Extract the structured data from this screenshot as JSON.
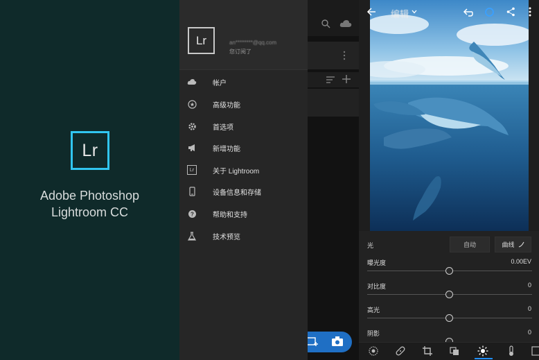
{
  "splash": {
    "logo_text": "Lr",
    "title_line1": "Adobe Photoshop",
    "title_line2": "Lightroom CC",
    "bg_color": "#0f2a2a",
    "accent": "#31c5f0"
  },
  "drawer": {
    "logo_text": "Lr",
    "user_email": "an********@qq.com",
    "user_status": "您订阅了",
    "menu": [
      {
        "icon": "cloud-icon",
        "label": "帐户"
      },
      {
        "icon": "star-circle-icon",
        "label": "高级功能"
      },
      {
        "icon": "gear-icon",
        "label": "首选项"
      },
      {
        "icon": "megaphone-icon",
        "label": "新增功能"
      },
      {
        "icon": "lr-icon",
        "icon_text": "Lr",
        "label": "关于 Lightroom"
      },
      {
        "icon": "phone-icon",
        "label": "设备信息和存储"
      },
      {
        "icon": "help-icon",
        "label": "帮助和支持"
      },
      {
        "icon": "flask-icon",
        "label": "技术预览"
      }
    ]
  },
  "editor": {
    "title": "编辑",
    "section": "光",
    "auto_label": "自动",
    "curve_label": "曲线",
    "sliders": [
      {
        "label": "曝光度",
        "value": "0.00EV",
        "level": 0.5
      },
      {
        "label": "对比度",
        "value": "0",
        "level": 0.5
      },
      {
        "label": "高光",
        "value": "0",
        "level": 0.5
      },
      {
        "label": "阴影",
        "value": "0",
        "level": 0.5
      }
    ],
    "tools": [
      "presets-icon",
      "healing-icon",
      "crop-icon",
      "selective-icon",
      "light-icon",
      "color-temp-icon",
      "effects-icon"
    ],
    "active_tool": "light-icon",
    "accent": "#1f8fff"
  },
  "icons": {
    "back": "back-arrow-icon",
    "undo": "undo-icon",
    "sync": "sync-icon",
    "share": "share-icon",
    "more": "more-vert-icon",
    "search": "search-icon",
    "cloud": "cloud-icon"
  }
}
